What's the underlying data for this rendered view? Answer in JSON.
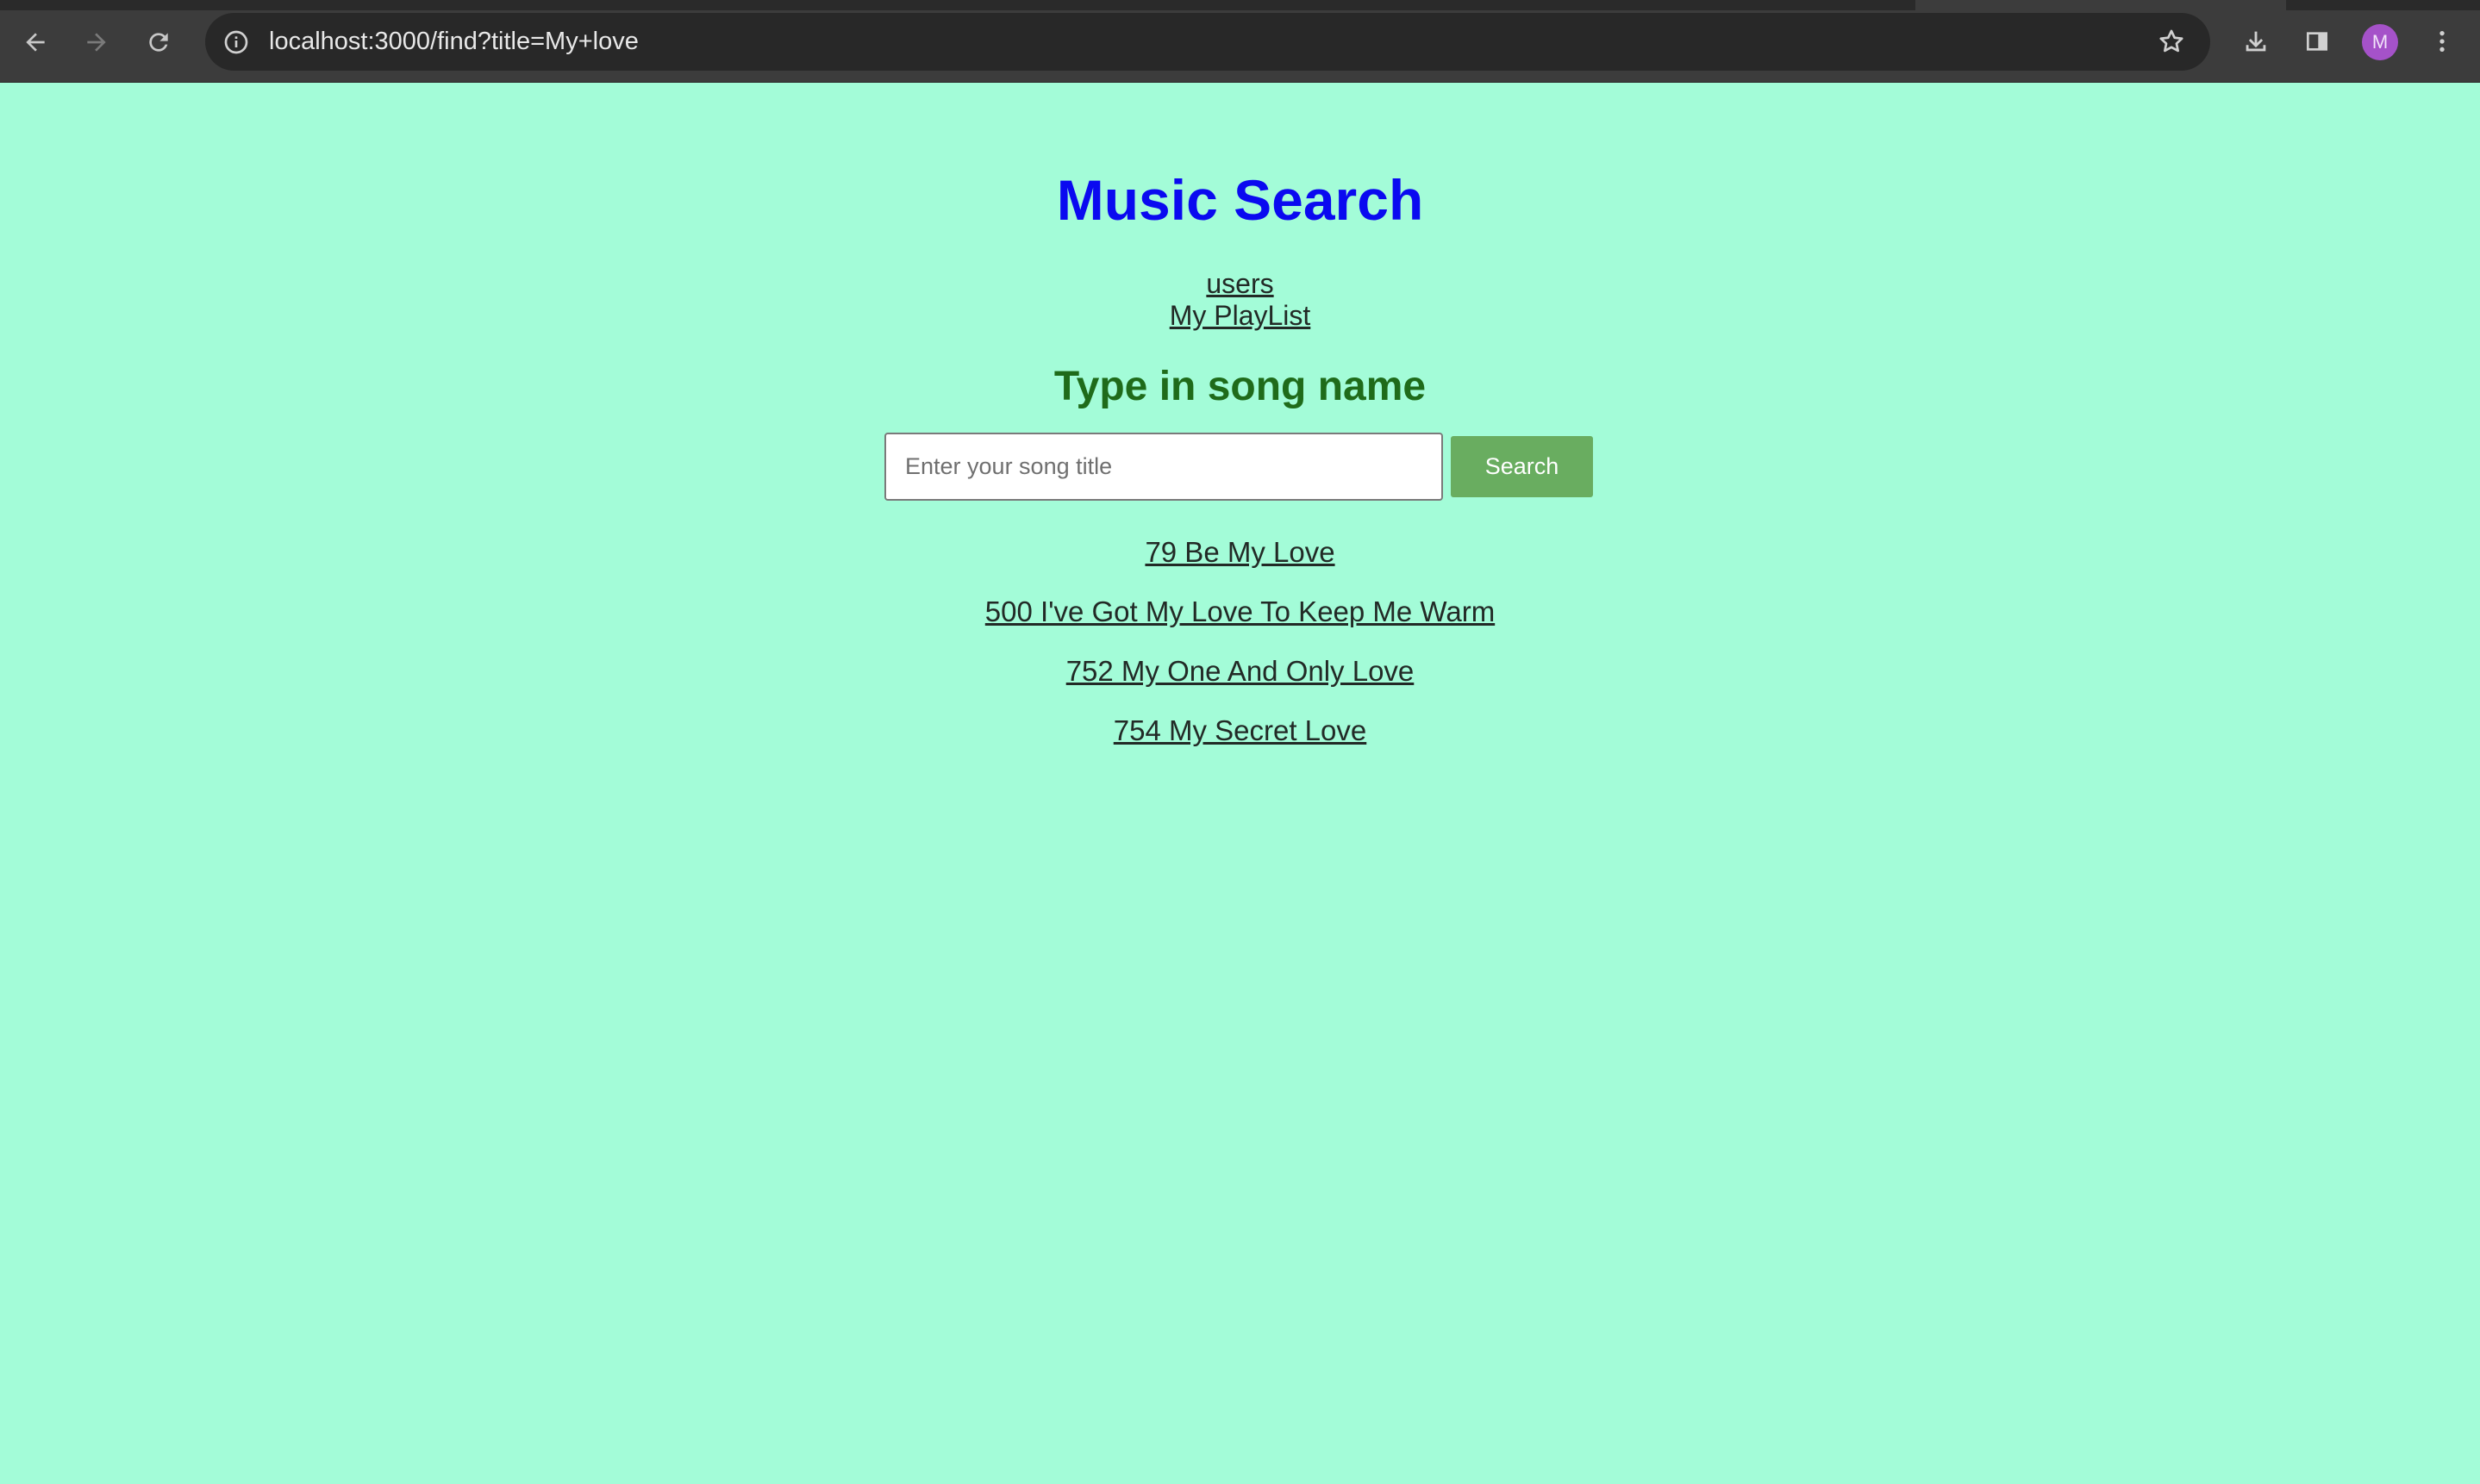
{
  "browser": {
    "url": "localhost:3000/find?title=My+love",
    "profile_initial": "M",
    "icons": {
      "back": "arrow-left-icon",
      "forward": "arrow-right-icon",
      "reload": "reload-icon",
      "site_info": "info-icon",
      "bookmark": "star-icon",
      "downloads": "download-icon",
      "side_panel": "side-panel-icon",
      "menu": "kebab-menu-icon"
    }
  },
  "page": {
    "title": "Music Search",
    "links": {
      "users": "users",
      "playlist": "My PlayList"
    },
    "subtitle": "Type in song name",
    "search": {
      "placeholder": "Enter your song title",
      "value": "",
      "button_label": "Search"
    },
    "results": [
      "79 Be My Love",
      "500 I've Got My Love To Keep Me Warm",
      "752 My One And Only Love",
      "754 My Secret Love"
    ]
  },
  "colors": {
    "page_background": "#a3fcd8",
    "title": "#0a0af0",
    "subtitle": "#1f6b1a",
    "search_button": "#69ad60",
    "link": "#222a26",
    "avatar": "#a552c9"
  }
}
